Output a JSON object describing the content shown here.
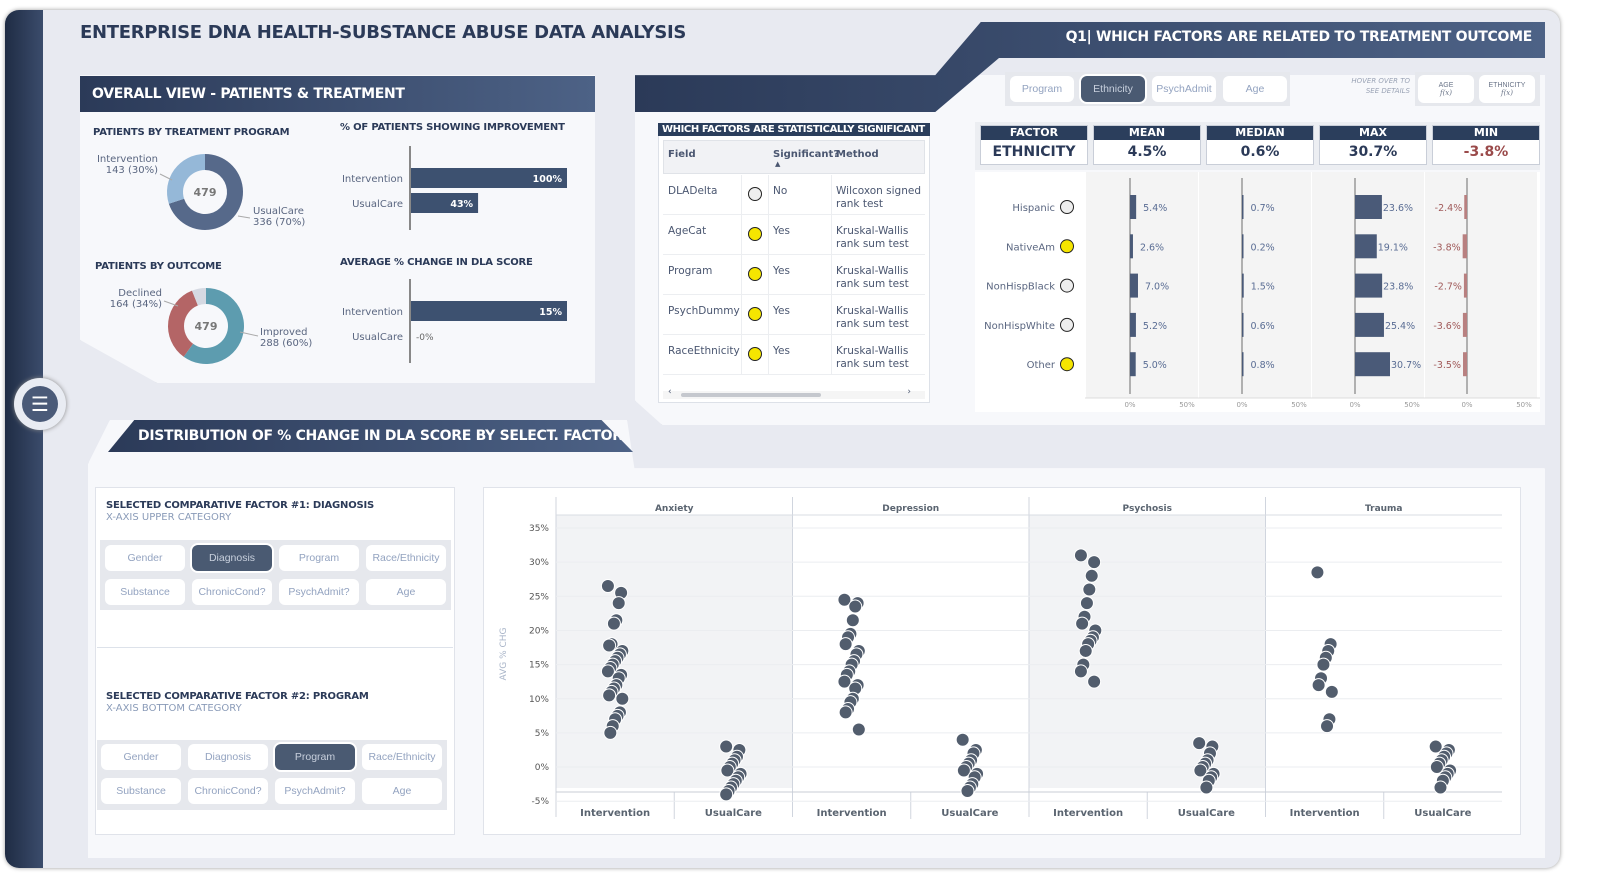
{
  "title": "ENTERPRISE DNA HEALTH-SUBSTANCE ABUSE DATA ANALYSIS",
  "colors": {
    "navy": "#2b3a58",
    "bar": "#3d5170",
    "donut_dark": "#56698a",
    "donut_light": "#95b8d8",
    "improved": "#5d9caf",
    "declined": "#b46566",
    "other": "#d5d9e2",
    "yellow": "#f5e500",
    "min_red": "#a05a5a",
    "dot": "#525d6d"
  },
  "overall": {
    "header": "OVERALL VIEW - PATIENTS & TREATMENT",
    "program_title": "PATIENTS BY TREATMENT PROGRAM",
    "program_total": "479",
    "program_slices": [
      {
        "label": "Intervention",
        "value": "143 (30%)",
        "share": 30
      },
      {
        "label": "UsualCare",
        "value": "336 (70%)",
        "share": 70
      }
    ],
    "outcome_title": "PATIENTS BY OUTCOME",
    "outcome_total": "479",
    "outcome_slices": [
      {
        "label": "Declined",
        "value": "164 (34%)",
        "share": 34
      },
      {
        "label": "Improved",
        "value": "288 (60%)",
        "share": 60
      }
    ],
    "improve_title": "% OF PATIENTS SHOWING IMPROVEMENT",
    "improve_bars": [
      {
        "label": "Intervention",
        "value": 100,
        "text": "100%"
      },
      {
        "label": "UsualCare",
        "value": 43,
        "text": "43%"
      }
    ],
    "dla_title": "AVERAGE % CHANGE IN DLA SCORE",
    "dla_bars": [
      {
        "label": "Intervention",
        "value": 15,
        "text": "15%"
      },
      {
        "label": "UsualCare",
        "value": 0,
        "text": "0%"
      }
    ]
  },
  "q1": {
    "header": "Q1| WHICH FACTORS ARE RELATED TO TREATMENT OUTCOME",
    "tabs": [
      {
        "label": "Program",
        "selected": false
      },
      {
        "label": "Ethnicity",
        "selected": true
      },
      {
        "label": "PsychAdmit",
        "selected": false
      },
      {
        "label": "Age",
        "selected": false
      }
    ],
    "hover_hint": [
      "HOVER OVER TO",
      "SEE DETAILS"
    ],
    "hover_buttons": [
      "AGE",
      "ETHNICITY"
    ],
    "table_title": "WHICH FACTORS ARE STATISTICALLY SIGNIFICANT",
    "columns": [
      "Field",
      "Significant?",
      "Method"
    ],
    "rows": [
      {
        "field": "DLADelta",
        "sig": "No",
        "m1": "Wilcoxon signed",
        "m2": "rank test"
      },
      {
        "field": "AgeCat",
        "sig": "Yes",
        "m1": "Kruskal-Wallis",
        "m2": "rank sum test"
      },
      {
        "field": "Program",
        "sig": "Yes",
        "m1": "Kruskal-Wallis",
        "m2": "rank sum test"
      },
      {
        "field": "PsychDummy",
        "sig": "Yes",
        "m1": "Kruskal-Wallis",
        "m2": "rank sum test"
      },
      {
        "field": "RaceEthnicity",
        "sig": "Yes",
        "m1": "Kruskal-Wallis",
        "m2": "rank sum test"
      }
    ],
    "cards": [
      {
        "h": "FACTOR",
        "v": "ETHNICITY"
      },
      {
        "h": "MEAN",
        "v": "4.5%"
      },
      {
        "h": "MEDIAN",
        "v": "0.6%"
      },
      {
        "h": "MAX",
        "v": "30.7%"
      },
      {
        "h": "MIN",
        "v": "-3.8%"
      }
    ],
    "ethnic_rows": [
      {
        "label": "Hispanic",
        "sig": false,
        "mean": 5.4,
        "median": 0.7,
        "max": 23.6,
        "min": -2.4
      },
      {
        "label": "NativeAm",
        "sig": true,
        "mean": 2.6,
        "median": 0.2,
        "max": 19.1,
        "min": -3.8
      },
      {
        "label": "NonHispBlack",
        "sig": false,
        "mean": 7.0,
        "median": 1.5,
        "max": 23.8,
        "min": -2.7
      },
      {
        "label": "NonHispWhite",
        "sig": false,
        "mean": 5.2,
        "median": 0.6,
        "max": 25.4,
        "min": -3.6
      },
      {
        "label": "Other",
        "sig": true,
        "mean": 5.0,
        "median": 0.8,
        "max": 30.7,
        "min": -3.5
      }
    ],
    "axis_ticks": [
      "0%",
      "50%"
    ]
  },
  "dist": {
    "header": "DISTRIBUTION OF % CHANGE IN DLA SCORE BY SELECT. FACTORS",
    "factor1": {
      "title": "SELECTED  COMPARATIVE FACTOR #1: DIAGNOSIS",
      "subtitle": "X-AXIS UPPER CATEGORY",
      "selected": "Diagnosis"
    },
    "factor2": {
      "title": "SELECTED  COMPARATIVE FACTOR #2: PROGRAM",
      "subtitle": "X-AXIS BOTTOM CATEGORY",
      "selected": "Program"
    },
    "options": [
      "Gender",
      "Diagnosis",
      "Program",
      "Race/Ethnicity",
      "Substance",
      "ChronicCond?",
      "PsychAdmit?",
      "Age"
    ]
  },
  "chart_data": {
    "type": "scatter",
    "ylabel": "AVG % CHG",
    "ylim": [
      -5,
      35
    ],
    "yticks": [
      "35%",
      "30%",
      "25%",
      "20%",
      "15%",
      "10%",
      "5%",
      "0%",
      "-5%"
    ],
    "facets": [
      "Anxiety",
      "Depression",
      "Psychosis",
      "Trauma"
    ],
    "categories": [
      "Intervention",
      "UsualCare"
    ],
    "grid": true,
    "points": {
      "Anxiety": {
        "Intervention": [
          26.5,
          25.5,
          24,
          21.5,
          21,
          18,
          17.8,
          17,
          16.5,
          16,
          15.5,
          15,
          14.5,
          14,
          13.5,
          13,
          12,
          11.5,
          11,
          10.5,
          10,
          8,
          7.5,
          7,
          6,
          5
        ],
        "UsualCare": [
          3,
          2.5,
          1.5,
          1,
          0.5,
          0,
          -0.5,
          -1,
          -1.5,
          -2,
          -2.5,
          -3,
          -3.5,
          -4
        ]
      },
      "Depression": {
        "Intervention": [
          24.5,
          24,
          23.5,
          21.5,
          19.5,
          19,
          18,
          17,
          16.5,
          15.5,
          15,
          14,
          13.5,
          12.5,
          12,
          11.5,
          10,
          9.5,
          8.5,
          8,
          5.5
        ],
        "UsualCare": [
          4,
          2.5,
          2,
          1,
          0.5,
          0,
          -0.5,
          -1,
          -1.5,
          -2.5,
          -3,
          -3.5
        ]
      },
      "Psychosis": {
        "Intervention": [
          31,
          30,
          28,
          26,
          24,
          22,
          21,
          20,
          19,
          18.5,
          18,
          17,
          15,
          14,
          12.5
        ],
        "UsualCare": [
          3.5,
          3,
          2,
          1,
          0.5,
          0,
          -0.5,
          -1,
          -1.5,
          -2,
          -3
        ]
      },
      "Trauma": {
        "Intervention": [
          28.5,
          18,
          17,
          16,
          15,
          13,
          12,
          11,
          7,
          6
        ],
        "UsualCare": [
          3,
          2.5,
          2,
          1.5,
          1,
          0.5,
          0,
          -0.5,
          -1,
          -1.5,
          -2,
          -3
        ]
      }
    }
  },
  "menu_icon": "hamburger-menu-icon"
}
